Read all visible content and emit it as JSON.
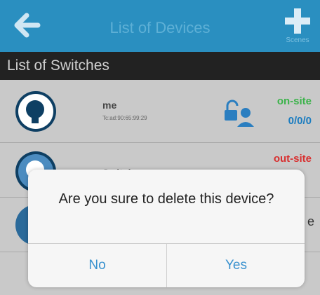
{
  "navbar": {
    "title": "List of Devices",
    "back_icon": "arrow-left-icon",
    "add_icon": "plus-icon",
    "scene_label": "Scenes",
    "color": "#2a8fc0"
  },
  "section": {
    "title": "List of Switches"
  },
  "devices": [
    {
      "name": "me",
      "mac": "Tc:ad:90:65:99:29",
      "status": "on-site",
      "status_color": "#3bb34a",
      "count": "0/0/0"
    },
    {
      "name": "Switch",
      "status": "out-site",
      "status_color": "#d83030"
    },
    {
      "name": "",
      "trailing": "e"
    }
  ],
  "dialog": {
    "message": "Are you sure to delete this device?",
    "no_label": "No",
    "yes_label": "Yes"
  }
}
